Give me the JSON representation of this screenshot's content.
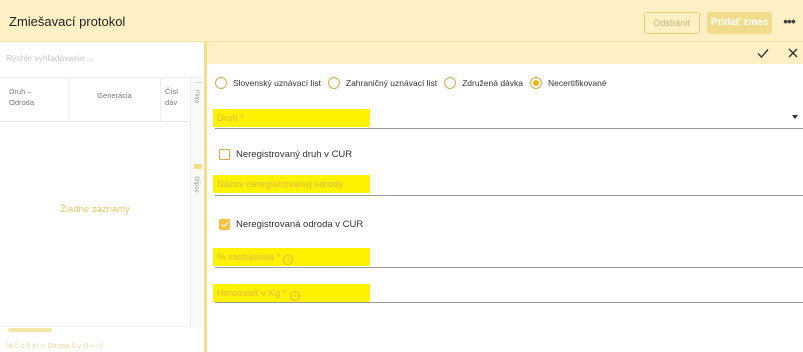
{
  "header": {
    "title": "Zmiešavací protokol",
    "remove_label": "Odstrániť",
    "add_label": "Pridať zmes",
    "more_label": "•••"
  },
  "grid": {
    "search_placeholder": "Rýchle vyhľadávanie ...",
    "columns": [
      {
        "line1": "Druh –",
        "line2": "Odroda"
      },
      {
        "line1": "Generácia",
        "line2": ""
      },
      {
        "line1": "Čísl",
        "line2": "dáv"
      }
    ],
    "side_tools": [
      "Filtre",
      "Stĺpce"
    ],
    "empty_text": "Žiadne záznamy",
    "pager_text": "Id 0 z 0    |<    <    Strana  0  z  0    >    >|"
  },
  "form": {
    "radio_options": [
      {
        "label": "Slovenský uznávací list",
        "selected": false
      },
      {
        "label": "Zahraničný uznávací list",
        "selected": false
      },
      {
        "label": "Združená dávka",
        "selected": false
      },
      {
        "label": "Necertifikované",
        "selected": true
      }
    ],
    "druh_label": "Druh *",
    "unreg_species_label": "Neregistrovaný druh v CUR",
    "unreg_species_checked": false,
    "variety_name_label": "Názov neregistrovanej odrody",
    "unreg_variety_label": "Neregistrovaná odroda v CUR",
    "unreg_variety_checked": true,
    "share_label": "% zastúpenia *",
    "weight_label": "Hmotnosť v Kg *",
    "info_glyph": "i"
  },
  "colors": {
    "header_bg": "#fcf0c4",
    "accent": "#f0b400",
    "highlight": "#fdf200",
    "label": "#e8b64a"
  },
  "icons": [
    "check-icon",
    "close-icon",
    "info-icon",
    "chevron-down-icon",
    "more-icon"
  ]
}
